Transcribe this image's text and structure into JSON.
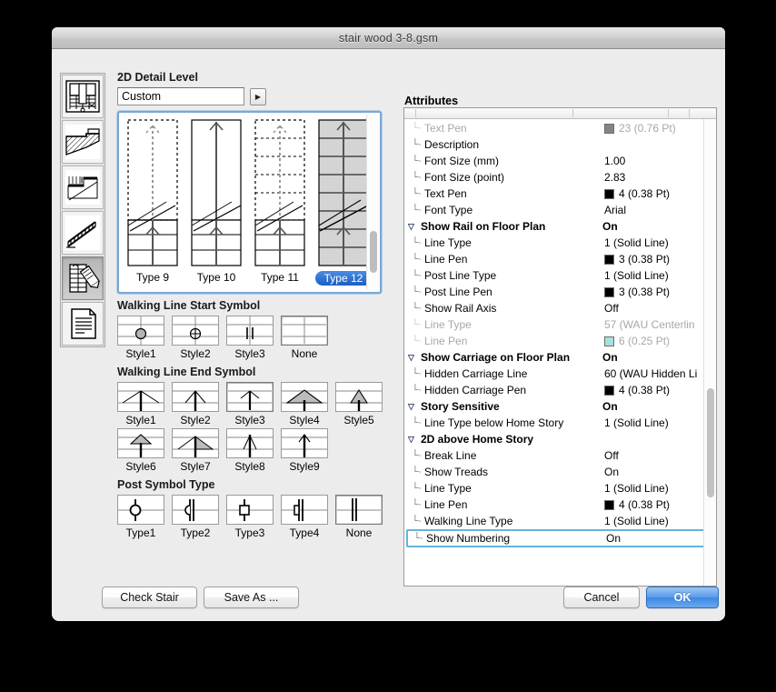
{
  "window": {
    "title": "stair wood 3-8.gsm"
  },
  "sidebar": {
    "items": [
      {
        "name": "plan-view-icon",
        "label": "Plan View"
      },
      {
        "name": "section-view-icon",
        "label": "Section View"
      },
      {
        "name": "profile-view-icon",
        "label": "Profile View"
      },
      {
        "name": "railing-view-icon",
        "label": "Railing View"
      },
      {
        "name": "2d-symbol-icon",
        "label": "2D Symbol"
      },
      {
        "name": "listing-icon",
        "label": "Listing"
      }
    ],
    "selected_index": 4
  },
  "left_panel": {
    "detail_level": {
      "title": "2D Detail Level",
      "value": "Custom",
      "arrow_glyph": "▶"
    },
    "types": {
      "items": [
        {
          "label": "Type 9",
          "selected": false
        },
        {
          "label": "Type 10",
          "selected": false
        },
        {
          "label": "Type 11",
          "selected": false
        },
        {
          "label": "Type 12",
          "selected": true
        }
      ]
    },
    "walking_line_start": {
      "title": "Walking Line Start Symbol",
      "items": [
        {
          "label": "Style1",
          "selected": false
        },
        {
          "label": "Style2",
          "selected": false
        },
        {
          "label": "Style3",
          "selected": false
        },
        {
          "label": "None",
          "selected": true
        }
      ]
    },
    "walking_line_end": {
      "title": "Walking Line End Symbol",
      "items": [
        {
          "label": "Style1",
          "selected": false
        },
        {
          "label": "Style2",
          "selected": false
        },
        {
          "label": "Style3",
          "selected": true
        },
        {
          "label": "Style4",
          "selected": false
        },
        {
          "label": "Style5",
          "selected": false
        },
        {
          "label": "Style6",
          "selected": false
        },
        {
          "label": "Style7",
          "selected": false
        },
        {
          "label": "Style8",
          "selected": false
        },
        {
          "label": "Style9",
          "selected": false
        }
      ]
    },
    "post_symbol": {
      "title": "Post Symbol Type",
      "items": [
        {
          "label": "Type1",
          "selected": false
        },
        {
          "label": "Type2",
          "selected": false
        },
        {
          "label": "Type3",
          "selected": false
        },
        {
          "label": "Type4",
          "selected": false
        },
        {
          "label": "None",
          "selected": true
        }
      ]
    }
  },
  "attributes": {
    "title": "Attributes",
    "rows": [
      {
        "label": "Text Pen",
        "value": "23 (0.76 Pt)",
        "swatch": "#848484",
        "indent": "child",
        "dim": true,
        "selected": false
      },
      {
        "label": "Description",
        "value": "",
        "swatch": null,
        "indent": "child",
        "dim": false,
        "selected": false
      },
      {
        "label": "Font Size (mm)",
        "value": "1.00",
        "swatch": null,
        "indent": "child",
        "dim": false,
        "selected": false
      },
      {
        "label": "Font Size (point)",
        "value": "2.83",
        "swatch": null,
        "indent": "child",
        "dim": false,
        "selected": false
      },
      {
        "label": "Text Pen",
        "value": "4 (0.38 Pt)",
        "swatch": "#000000",
        "indent": "child",
        "dim": false,
        "selected": false
      },
      {
        "label": "Font Type",
        "value": "Arial",
        "swatch": null,
        "indent": "child",
        "dim": false,
        "selected": false
      },
      {
        "label": "Show Rail on Floor Plan",
        "value": "On",
        "swatch": null,
        "indent": "group",
        "dim": false,
        "selected": false
      },
      {
        "label": "Line Type",
        "value": "1 (Solid Line)",
        "swatch": null,
        "indent": "child",
        "dim": false,
        "selected": false
      },
      {
        "label": "Line Pen",
        "value": "3 (0.38 Pt)",
        "swatch": "#000000",
        "indent": "child",
        "dim": false,
        "selected": false
      },
      {
        "label": "Post Line Type",
        "value": "1 (Solid Line)",
        "swatch": null,
        "indent": "child",
        "dim": false,
        "selected": false
      },
      {
        "label": "Post Line Pen",
        "value": "3 (0.38 Pt)",
        "swatch": "#000000",
        "indent": "child",
        "dim": false,
        "selected": false
      },
      {
        "label": "Show Rail Axis",
        "value": "Off",
        "swatch": null,
        "indent": "child",
        "dim": false,
        "selected": false
      },
      {
        "label": "Line Type",
        "value": "57 (WAU Centerlin",
        "swatch": null,
        "indent": "child",
        "dim": true,
        "selected": false
      },
      {
        "label": "Line Pen",
        "value": "6 (0.25 Pt)",
        "swatch": "#a8dfdf",
        "indent": "child",
        "dim": true,
        "selected": false
      },
      {
        "label": "Show Carriage on Floor Plan",
        "value": "On",
        "swatch": null,
        "indent": "group",
        "dim": false,
        "selected": false
      },
      {
        "label": "Hidden Carriage Line",
        "value": "60 (WAU Hidden Li",
        "swatch": null,
        "indent": "child",
        "dim": false,
        "selected": false
      },
      {
        "label": "Hidden Carriage Pen",
        "value": "4 (0.38 Pt)",
        "swatch": "#000000",
        "indent": "child",
        "dim": false,
        "selected": false
      },
      {
        "label": "Story Sensitive",
        "value": "On",
        "swatch": null,
        "indent": "group",
        "dim": false,
        "selected": false
      },
      {
        "label": "Line Type below Home Story",
        "value": "1 (Solid Line)",
        "swatch": null,
        "indent": "child",
        "dim": false,
        "selected": false
      },
      {
        "label": "2D above Home Story",
        "value": "",
        "swatch": null,
        "indent": "group",
        "dim": false,
        "selected": false
      },
      {
        "label": "Break Line",
        "value": "Off",
        "swatch": null,
        "indent": "child",
        "dim": false,
        "selected": false
      },
      {
        "label": "Show Treads",
        "value": "On",
        "swatch": null,
        "indent": "child",
        "dim": false,
        "selected": false
      },
      {
        "label": "Line Type",
        "value": "1 (Solid Line)",
        "swatch": null,
        "indent": "child",
        "dim": false,
        "selected": false
      },
      {
        "label": "Line Pen",
        "value": "4 (0.38 Pt)",
        "swatch": "#000000",
        "indent": "child",
        "dim": false,
        "selected": false
      },
      {
        "label": "Walking Line Type",
        "value": "1 (Solid Line)",
        "swatch": null,
        "indent": "child",
        "dim": false,
        "selected": false
      },
      {
        "label": "Show Numbering",
        "value": "On",
        "swatch": null,
        "indent": "child",
        "dim": false,
        "selected": true
      }
    ]
  },
  "footer": {
    "check_stair": "Check Stair",
    "save_as": "Save As ...",
    "cancel": "Cancel",
    "ok": "OK"
  },
  "colors": {
    "selection_blue": "#2d71d0",
    "focus_ring": "#63b3e0",
    "dialog_bg": "#ececec"
  }
}
